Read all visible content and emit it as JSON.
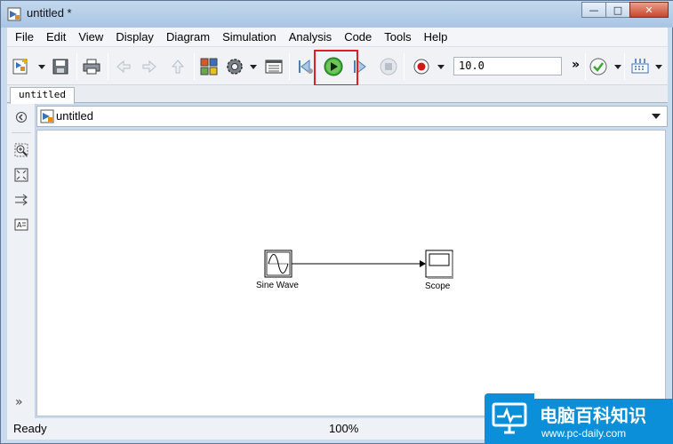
{
  "window": {
    "title": "untitled *",
    "controls": {
      "minimize": "—",
      "maximize": "□",
      "close": "✕"
    }
  },
  "menubar": {
    "items": [
      "File",
      "Edit",
      "View",
      "Display",
      "Diagram",
      "Simulation",
      "Analysis",
      "Code",
      "Tools",
      "Help"
    ]
  },
  "toolbar": {
    "stop_time": "10.0",
    "more": "»",
    "icons": [
      "new-model-icon",
      "save-icon",
      "print-icon",
      "back-icon",
      "forward-icon",
      "up-icon",
      "library-browser-icon",
      "model-settings-icon",
      "model-explorer-icon",
      "step-back-icon",
      "run-icon",
      "step-forward-icon",
      "stop-icon",
      "record-icon",
      "check-model-icon",
      "build-icon"
    ],
    "colors": {
      "run_green": "#3aa832",
      "highlight": "#e02020",
      "record_red": "#d01818"
    }
  },
  "tabs": [
    {
      "label": "untitled"
    }
  ],
  "address": {
    "path": "untitled"
  },
  "canvas": {
    "blocks": [
      {
        "label": "Sine Wave",
        "type": "source"
      },
      {
        "label": "Scope",
        "type": "sink"
      }
    ]
  },
  "palette": {
    "more": "»"
  },
  "status": {
    "left": "Ready",
    "zoom": "100%"
  },
  "watermark": {
    "brand": "电脑百科知识",
    "url": "www.pc-daily.com",
    "color": "#0a8fd8"
  }
}
